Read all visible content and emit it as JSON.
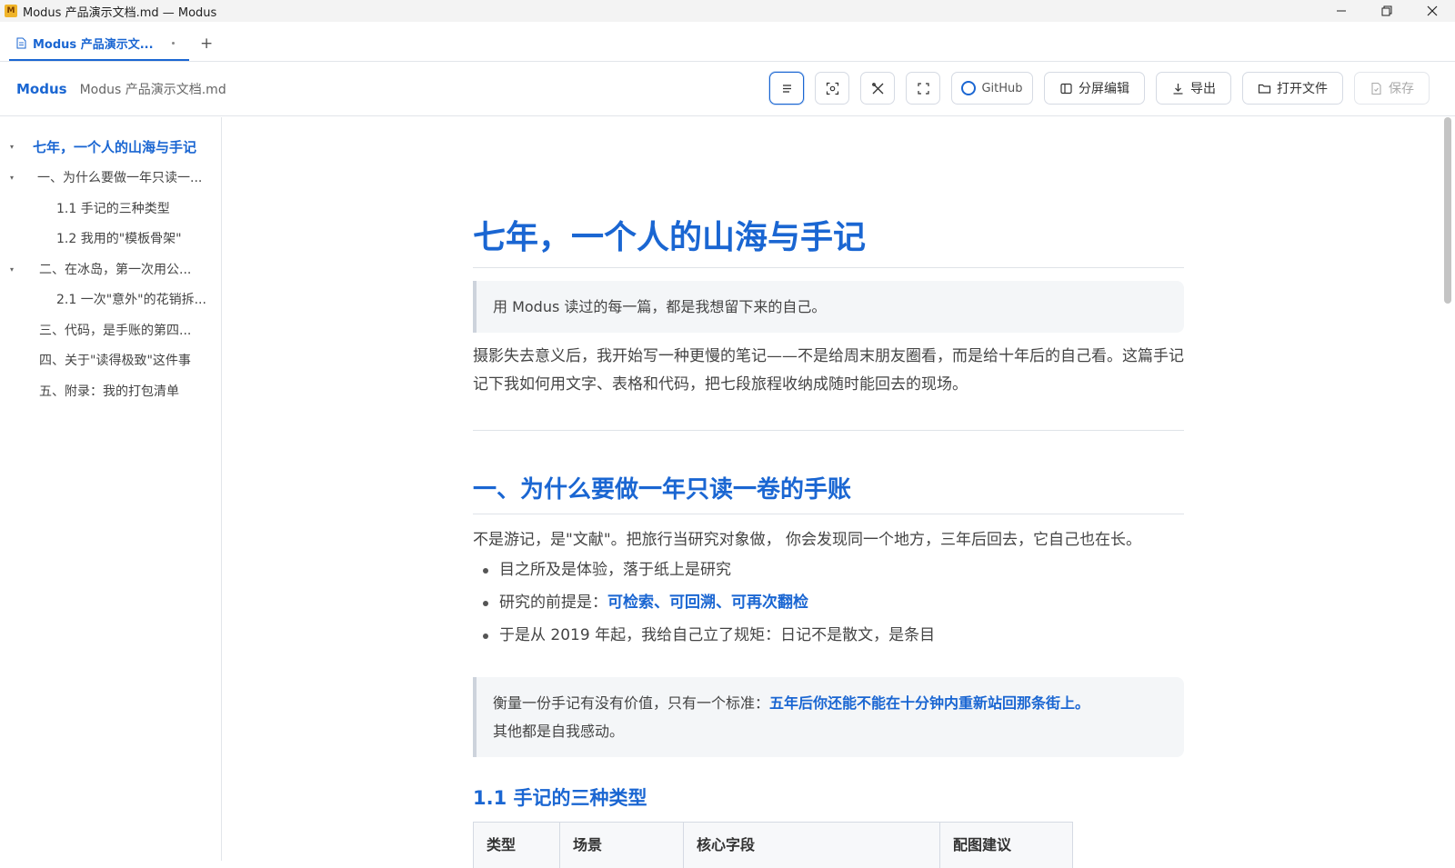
{
  "window": {
    "title": "Modus 产品演示文档.md — Modus",
    "logo_letter": "M"
  },
  "tab": {
    "label": "Modus 产品演示文...",
    "add_label": "+"
  },
  "header": {
    "brand": "Modus",
    "document": "Modus 产品演示文档.md"
  },
  "toolbar": {
    "github_label": "GitHub",
    "split_label": "分屏编辑",
    "export_label": "导出",
    "open_label": "打开文件",
    "save_label": "保存"
  },
  "toc": [
    {
      "text": "七年，一个人的山海与手记",
      "arrow": "▾"
    },
    {
      "text": "一、为什么要做一年只读一...",
      "arrow": "▾"
    },
    {
      "text": "1.1 手记的三种类型",
      "arrow": ""
    },
    {
      "text": "1.2 我用的\"模板骨架\"",
      "arrow": ""
    },
    {
      "text": "二、在冰岛，第一次用公...",
      "arrow": "▾"
    },
    {
      "text": "2.1 一次\"意外\"的花销拆...",
      "arrow": ""
    },
    {
      "text": "三、代码，是手账的第四...",
      "arrow": ""
    },
    {
      "text": "四、关于\"读得极致\"这件事",
      "arrow": ""
    },
    {
      "text": "五、附录：我的打包清单",
      "arrow": ""
    }
  ],
  "doc": {
    "h1": "七年，一个人的山海与手记",
    "quote1": "用 Modus 读过的每一篇，都是我想留下来的自己。",
    "intro": "摄影失去意义后，我开始写一种更慢的笔记——不是给周末朋友圈看，而是给十年后的自己看。这篇手记记下我如何用文字、表格和代码，把七段旅程收纳成随时能回去的现场。",
    "h2": "一、为什么要做一年只读一卷的手账",
    "p2": "不是游记，是\"文献\"。把旅行当研究对象做， 你会发现同一个地方，三年后回去，它自己也在长。",
    "bullet1": "目之所及是体验，落于纸上是研究",
    "bullet2_prefix": "研究的前提是：",
    "bullet2_bold": "可检索、可回溯、可再次翻检",
    "bullet3": "于是从 2019 年起，我给自己立了规矩：日记不是散文，是条目",
    "quote2_prefix": "衡量一份手记有没有价值，只有一个标准：",
    "quote2_bold": "五年后你还能不能在十分钟内重新站回那条街上。",
    "quote2_suffix": "其他都是自我感动。",
    "h3": "1.1 手记的三种类型",
    "table_headers": [
      "类型",
      "场景",
      "核心字段",
      "配图建议"
    ]
  }
}
